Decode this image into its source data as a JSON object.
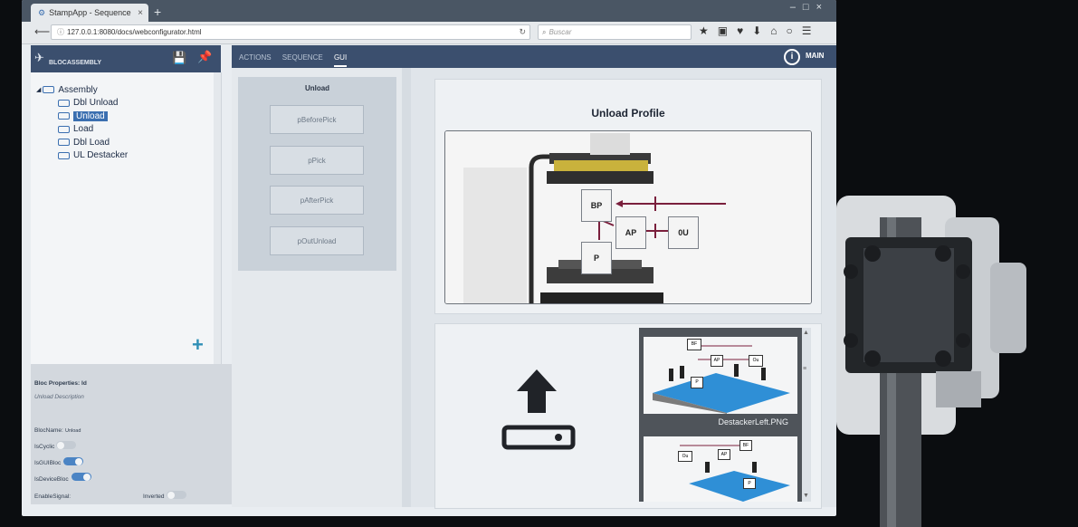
{
  "browser": {
    "tab_title": "StampApp - Sequence",
    "url": "127.0.0.1:8080/docs/webconfigurator.html",
    "search_placeholder": "Buscar"
  },
  "header": {
    "bloc_title": "BLOCASSEMBLY",
    "tabs": [
      {
        "label": "ACTIONS"
      },
      {
        "label": "SEQUENCE"
      },
      {
        "label": "GUI"
      }
    ],
    "active_tab": "GUI",
    "main_label": "MAIN"
  },
  "tree": {
    "root": "Assembly",
    "children": [
      "Dbl Unload",
      "Unload",
      "Load",
      "Dbl Load",
      "UL Destacker"
    ],
    "selected": "Unload"
  },
  "properties": {
    "bloc_properties_label": "Bloc Properties: Id",
    "description": "Unload Description",
    "blocname_label": "BlocName:",
    "blocname_value": "Unload",
    "iscyclic_label": "IsCyclic",
    "iscyclic_on": false,
    "isguibloc_label": "IsGUIBloc",
    "isguibloc_on": true,
    "isdevicebloc_label": "IsDeviceBloc",
    "isdevicebloc_on": true,
    "enablesignal_label": "EnableSignal:",
    "inverted_label": "Inverted",
    "inverted_on": false
  },
  "actions": {
    "title": "Unload",
    "buttons": [
      "pBeforePick",
      "pPick",
      "pAfterPick",
      "pOutUnload"
    ]
  },
  "gui": {
    "profile_title": "Unload Profile",
    "diagram_boxes": [
      "BP",
      "AP",
      "0U",
      "P"
    ],
    "thumbnail_label": "DestackerLeft.PNG",
    "thumb_boxes_1": [
      "BF",
      "AP",
      "Ou",
      "P"
    ],
    "thumb_boxes_2": [
      "BF",
      "AP",
      "Ou",
      "P"
    ]
  },
  "colors": {
    "header_blue": "#3b4f6e",
    "selection_blue": "#3b6fb0",
    "plus_teal": "#2f8fb6",
    "arrow_maroon": "#7a1f3c"
  }
}
